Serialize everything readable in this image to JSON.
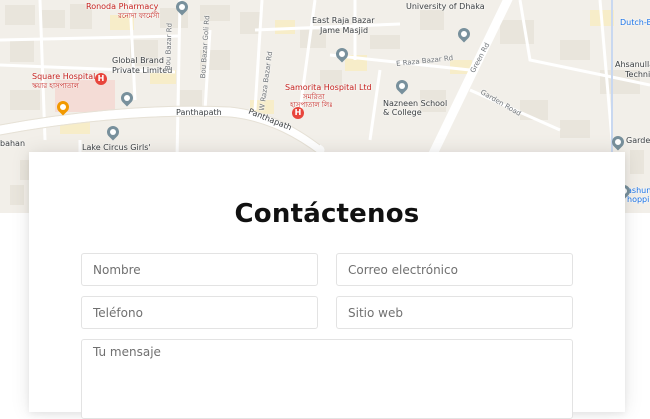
{
  "map": {
    "labels": {
      "ronoda_pharmacy": "Ronoda Pharmacy",
      "ronoda_pharmacy_bn": "রনোদা ফার্মেসী",
      "university": "University of Dhaka",
      "dutch_bangla": "Dutch-B",
      "east_raja_bazar": "East Raja Bazar",
      "jame_masjid": "Jame Masjid",
      "global_brand": "Global Brand",
      "private_limited": "Private Limited",
      "square_hospital": "Square Hospital",
      "square_hospital_bn": "স্কয়ার হাসপাতাল",
      "samorita_hospital": "Samorita Hospital Ltd",
      "samorita_hospital_bn_1": "সমরিতা",
      "samorita_hospital_bn_2": "হাসপাতাল লিঃ",
      "nazneen_school": "Nazneen School",
      "and_college": "& College",
      "ahsanullah": "Ahsanulla",
      "technical": "Techni",
      "panthapath_1": "Panthapath",
      "panthapath_2": "Panthapath",
      "lake_circus": "Lake Circus Girls'",
      "bahan": "bahan",
      "garden": "Garde",
      "bashundhara": "ashund",
      "shopping": "hoppin",
      "street_bou_bazar": "Bou Bazar Rd",
      "street_bou_bazar_goli": "Bou Bazar Goli Rd",
      "street_raza_bazar": "W Raza Bazar Rd",
      "street_e_raza_bazar": "E Raza Bazar Rd",
      "street_green": "Green Rd",
      "street_garden": "Garden Road"
    },
    "icons": [
      "hospital-icon",
      "restaurant-icon",
      "place-pin-icon"
    ]
  },
  "contact": {
    "title": "Contáctenos",
    "fields": {
      "name_placeholder": "Nombre",
      "email_placeholder": "Correo electrónico",
      "phone_placeholder": "Teléfono",
      "website_placeholder": "Sitio web",
      "message_placeholder": "Tu mensaje"
    }
  },
  "colors": {
    "map_background": "#f2efe9",
    "map_road": "#ffffff",
    "hospital_red": "#e8453c",
    "card_background": "#ffffff",
    "title_text": "#111111",
    "field_border": "#e3e3e3",
    "placeholder_text": "#707070"
  }
}
